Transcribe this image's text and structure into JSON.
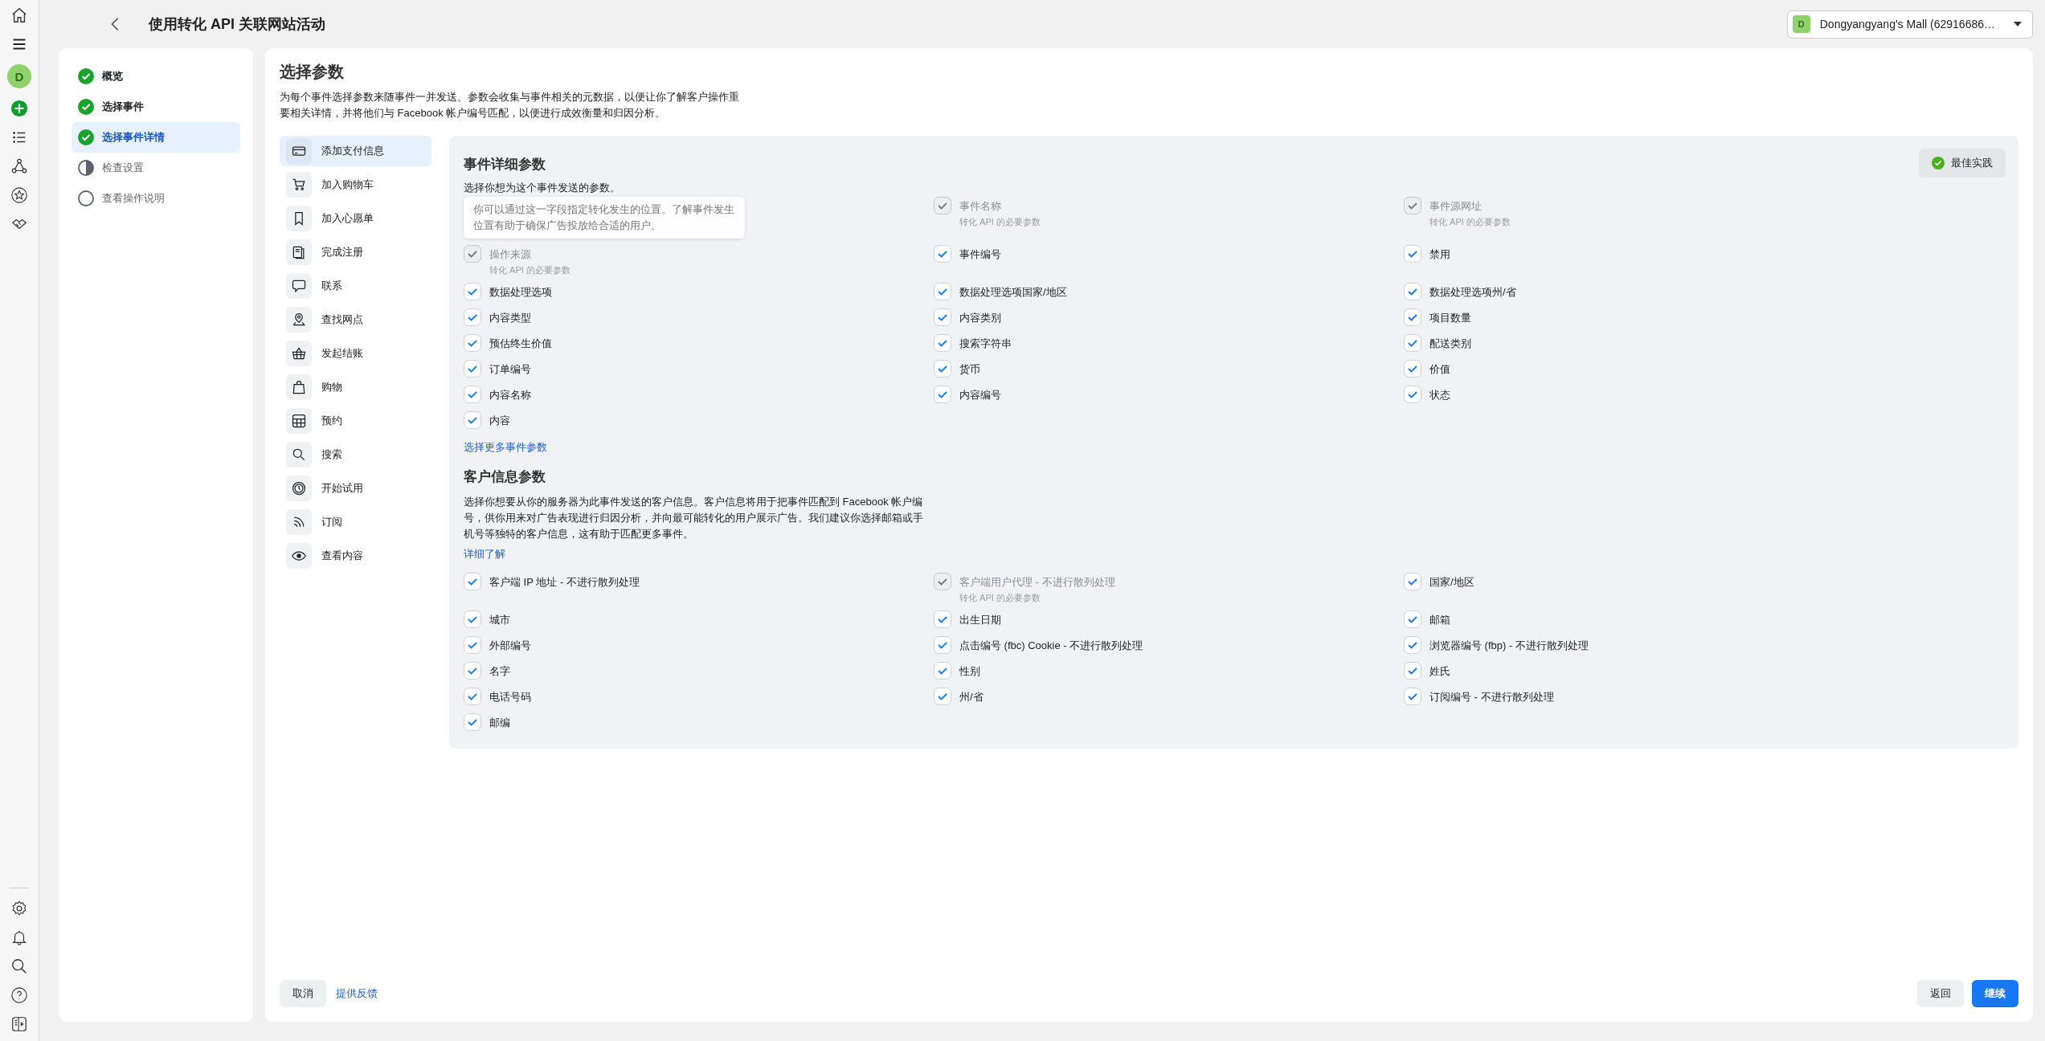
{
  "header": {
    "title": "使用转化 API 关联网站活动",
    "account": {
      "initial": "D",
      "name": "Dongyangyang's Mall (62916686…"
    }
  },
  "rail": {
    "avatar": "D"
  },
  "steps": [
    {
      "label": "概览",
      "completed": true,
      "in_progress": false,
      "selected": false
    },
    {
      "label": "选择事件",
      "completed": true,
      "in_progress": false,
      "selected": false
    },
    {
      "label": "选择事件详情",
      "completed": true,
      "in_progress": false,
      "selected": true
    },
    {
      "label": "检查设置",
      "completed": false,
      "in_progress": true,
      "selected": false
    },
    {
      "label": "查看操作说明",
      "completed": false,
      "in_progress": false,
      "selected": false
    }
  ],
  "page": {
    "title": "选择参数",
    "description": "为每个事件选择参数来随事件一并发送。参数会收集与事件相关的元数据，以便让你了解客户操作重要相关详情，并将他们与 Facebook 帐户编号匹配，以便进行成效衡量和归因分析。"
  },
  "events": [
    {
      "label": "添加支付信息",
      "selected": true
    },
    {
      "label": "加入购物车",
      "selected": false
    },
    {
      "label": "加入心愿单",
      "selected": false
    },
    {
      "label": "完成注册",
      "selected": false
    },
    {
      "label": "联系",
      "selected": false
    },
    {
      "label": "查找网点",
      "selected": false
    },
    {
      "label": "发起结账",
      "selected": false
    },
    {
      "label": "购物",
      "selected": false
    },
    {
      "label": "预约",
      "selected": false
    },
    {
      "label": "搜索",
      "selected": false
    },
    {
      "label": "开始试用",
      "selected": false
    },
    {
      "label": "订阅",
      "selected": false
    },
    {
      "label": "查看内容",
      "selected": false
    }
  ],
  "event_params": {
    "title": "事件详细参数",
    "best_practice": "最佳实践",
    "description": "选择你想为这个事件发送的参数。",
    "items": [
      {
        "kind": "tooltip",
        "text": "你可以通过这一字段指定转化发生的位置。了解事件发生位置有助于确保广告投放给合适的用户。"
      },
      {
        "kind": "checkbox",
        "label": "事件名称",
        "checked": true,
        "disabled": true,
        "note": "转化 API 的必要参数"
      },
      {
        "kind": "checkbox",
        "label": "事件源网址",
        "checked": true,
        "disabled": true,
        "note": "转化 API 的必要参数"
      },
      {
        "kind": "checkbox",
        "label": "操作来源",
        "checked": true,
        "disabled": true,
        "note": "转化 API 的必要参数"
      },
      {
        "kind": "checkbox",
        "label": "事件编号",
        "checked": true,
        "disabled": false
      },
      {
        "kind": "checkbox",
        "label": "禁用",
        "checked": true,
        "disabled": false
      },
      {
        "kind": "checkbox",
        "label": "数据处理选项",
        "checked": true,
        "disabled": false
      },
      {
        "kind": "checkbox",
        "label": "数据处理选项国家/地区",
        "checked": true,
        "disabled": false
      },
      {
        "kind": "checkbox",
        "label": "数据处理选项州/省",
        "checked": true,
        "disabled": false
      },
      {
        "kind": "checkbox",
        "label": "内容类型",
        "checked": true,
        "disabled": false
      },
      {
        "kind": "checkbox",
        "label": "内容类别",
        "checked": true,
        "disabled": false
      },
      {
        "kind": "checkbox",
        "label": "项目数量",
        "checked": true,
        "disabled": false
      },
      {
        "kind": "checkbox",
        "label": "预估终生价值",
        "checked": true,
        "disabled": false
      },
      {
        "kind": "checkbox",
        "label": "搜索字符串",
        "checked": true,
        "disabled": false
      },
      {
        "kind": "checkbox",
        "label": "配送类别",
        "checked": true,
        "disabled": false
      },
      {
        "kind": "checkbox",
        "label": "订单编号",
        "checked": true,
        "disabled": false
      },
      {
        "kind": "checkbox",
        "label": "货币",
        "checked": true,
        "disabled": false
      },
      {
        "kind": "checkbox",
        "label": "价值",
        "checked": true,
        "disabled": false
      },
      {
        "kind": "checkbox",
        "label": "内容名称",
        "checked": true,
        "disabled": false
      },
      {
        "kind": "checkbox",
        "label": "内容编号",
        "checked": true,
        "disabled": false
      },
      {
        "kind": "checkbox",
        "label": "状态",
        "checked": true,
        "disabled": false
      },
      {
        "kind": "checkbox",
        "label": "内容",
        "checked": true,
        "disabled": false
      }
    ],
    "more_link": "选择更多事件参数"
  },
  "customer_params": {
    "title": "客户信息参数",
    "description": "选择你想要从你的服务器为此事件发送的客户信息。客户信息将用于把事件匹配到 Facebook 帐户编号，供你用来对广告表现进行归因分析，并向最可能转化的用户展示广告。我们建议你选择邮箱或手机号等独特的客户信息，这有助于匹配更多事件。",
    "learn_more": "详细了解",
    "items": [
      {
        "kind": "checkbox",
        "label": "客户端 IP 地址 - 不进行散列处理",
        "checked": true,
        "disabled": false
      },
      {
        "kind": "checkbox",
        "label": "客户端用户代理 - 不进行散列处理",
        "checked": true,
        "disabled": true,
        "note": "转化 API 的必要参数"
      },
      {
        "kind": "checkbox",
        "label": "国家/地区",
        "checked": true,
        "disabled": false
      },
      {
        "kind": "checkbox",
        "label": "城市",
        "checked": true,
        "disabled": false
      },
      {
        "kind": "checkbox",
        "label": "出生日期",
        "checked": true,
        "disabled": false
      },
      {
        "kind": "checkbox",
        "label": "邮箱",
        "checked": true,
        "disabled": false
      },
      {
        "kind": "checkbox",
        "label": "外部编号",
        "checked": true,
        "disabled": false
      },
      {
        "kind": "checkbox",
        "label": "点击编号 (fbc) Cookie - 不进行散列处理",
        "checked": true,
        "disabled": false
      },
      {
        "kind": "checkbox",
        "label": "浏览器编号 (fbp) - 不进行散列处理",
        "checked": true,
        "disabled": false
      },
      {
        "kind": "checkbox",
        "label": "名字",
        "checked": true,
        "disabled": false
      },
      {
        "kind": "checkbox",
        "label": "性别",
        "checked": true,
        "disabled": false
      },
      {
        "kind": "checkbox",
        "label": "姓氏",
        "checked": true,
        "disabled": false
      },
      {
        "kind": "checkbox",
        "label": "电话号码",
        "checked": true,
        "disabled": false
      },
      {
        "kind": "checkbox",
        "label": "州/省",
        "checked": true,
        "disabled": false
      },
      {
        "kind": "checkbox",
        "label": "订阅编号 - 不进行散列处理",
        "checked": true,
        "disabled": false
      },
      {
        "kind": "checkbox",
        "label": "邮编",
        "checked": true,
        "disabled": false
      }
    ]
  },
  "footer": {
    "cancel": "取消",
    "feedback": "提供反馈",
    "back": "返回",
    "next": "继续"
  }
}
